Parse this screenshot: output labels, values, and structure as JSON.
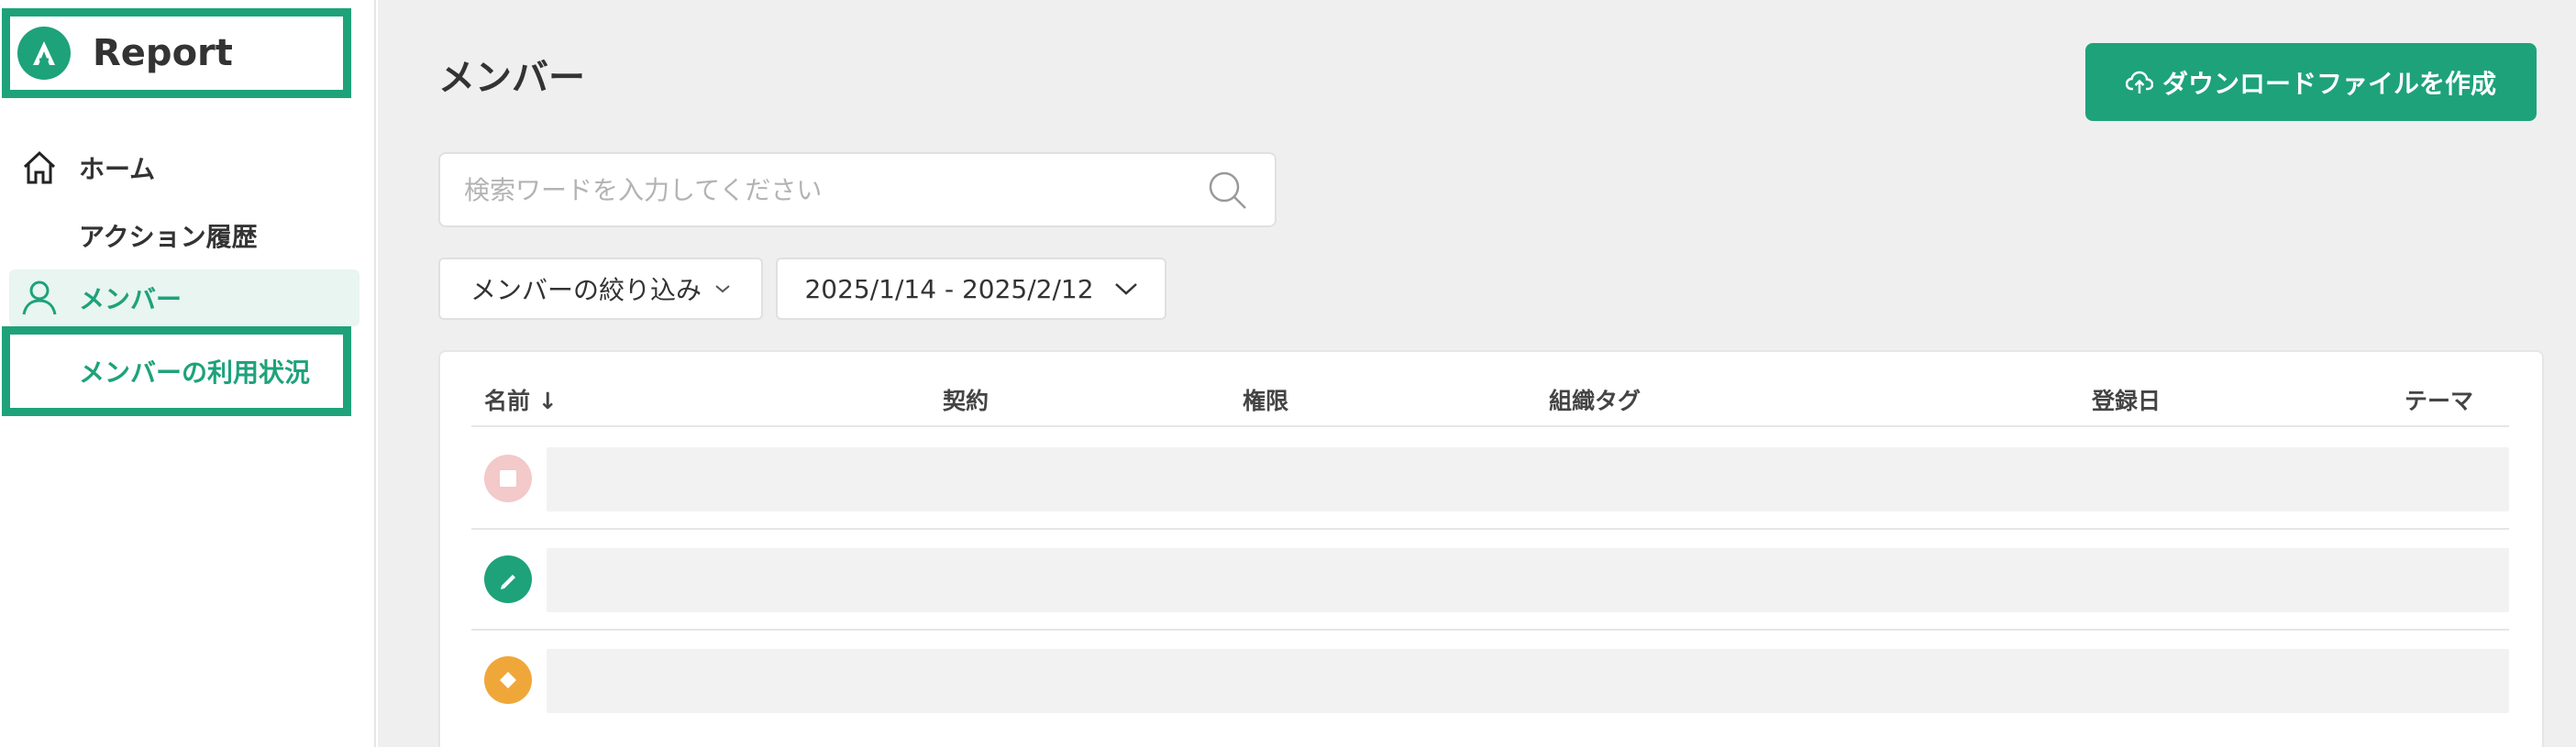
{
  "app": {
    "name": "Report"
  },
  "sidebar": {
    "items": [
      {
        "label": "ホーム"
      },
      {
        "label": "アクション履歴"
      },
      {
        "label": "メンバー"
      },
      {
        "label": "メンバーの利用状況"
      }
    ]
  },
  "page": {
    "title": "メンバー",
    "download_button": "ダウンロードファイルを作成"
  },
  "search": {
    "placeholder": "検索ワードを入力してください"
  },
  "filters": {
    "member_filter": "メンバーの絞り込み",
    "date_range": "2025/1/14 - 2025/2/12"
  },
  "table": {
    "columns": [
      "名前 ↓",
      "契約",
      "権限",
      "組織タグ",
      "登録日",
      "テーマ"
    ],
    "rows": [
      {
        "avatar_color": "#f3c9c9",
        "avatar_icon": "square-icon"
      },
      {
        "avatar_color": "#1ea27a",
        "avatar_icon": "pencil-icon"
      },
      {
        "avatar_color": "#f0a73a",
        "avatar_icon": "diamond-icon"
      }
    ]
  },
  "colors": {
    "accent": "#1ea27a",
    "accent_light": "#e8f5f0",
    "background": "#efefef"
  }
}
